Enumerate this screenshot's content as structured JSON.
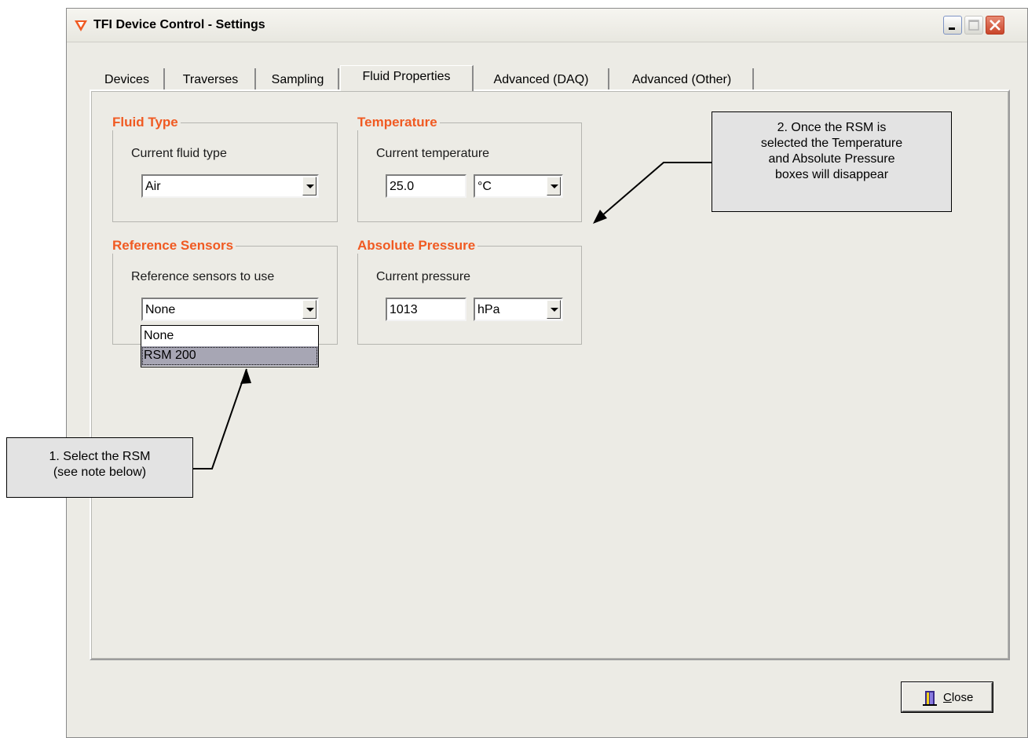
{
  "window": {
    "title": "TFI Device Control - Settings",
    "controls": [
      "minimize",
      "maximize",
      "close"
    ]
  },
  "tabs": [
    {
      "label": "Devices",
      "active": false
    },
    {
      "label": "Traverses",
      "active": false
    },
    {
      "label": "Sampling",
      "active": false
    },
    {
      "label": "Fluid Properties",
      "active": true
    },
    {
      "label": "Advanced (DAQ)",
      "active": false
    },
    {
      "label": "Advanced (Other)",
      "active": false
    }
  ],
  "groups": {
    "fluid_type": {
      "title": "Fluid Type",
      "label": "Current fluid type",
      "value": "Air"
    },
    "temperature": {
      "title": "Temperature",
      "label": "Current temperature",
      "value": "25.0",
      "unit": "°C"
    },
    "reference_sensors": {
      "title": "Reference Sensors",
      "label": "Reference sensors to use",
      "value": "None",
      "options": [
        "None",
        "RSM 200"
      ],
      "highlighted_option": "RSM 200"
    },
    "absolute_pressure": {
      "title": "Absolute Pressure",
      "label": "Current pressure",
      "value": "1013",
      "unit": "hPa"
    }
  },
  "callouts": {
    "step1": {
      "line1": "1. Select the RSM",
      "line2": "(see note below)"
    },
    "step2": {
      "line1": "2. Once the RSM is",
      "line2": "selected the Temperature",
      "line3": "and Absolute Pressure",
      "line4": "boxes will disappear"
    }
  },
  "close_button": {
    "label_mnemonic": "C",
    "label_rest": "lose"
  },
  "colors": {
    "group_title": "#f05a22",
    "window_bg": "#ecebe5",
    "selection": "#a7a6b4",
    "close_red": "#c9452a"
  }
}
